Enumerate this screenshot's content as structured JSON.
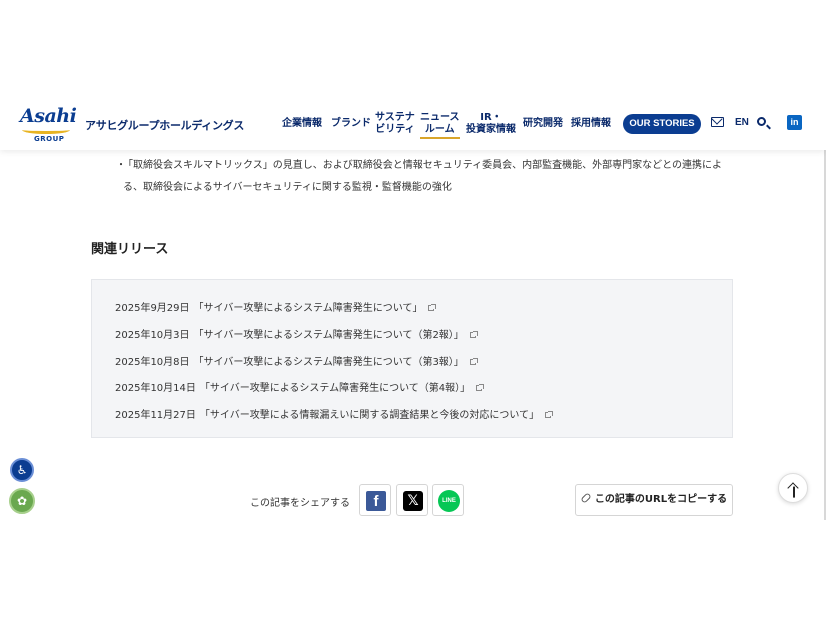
{
  "header": {
    "logo": {
      "word": "Asahi",
      "sub": "GROUP"
    },
    "company_name": "アサヒグループホールディングス",
    "nav": [
      {
        "line1": "企業情報",
        "line2": ""
      },
      {
        "line1": "ブランド",
        "line2": ""
      },
      {
        "line1": "サステナ",
        "line2": "ビリティ"
      },
      {
        "line1": "ニュース",
        "line2": "ルーム"
      },
      {
        "line1": "IR・",
        "line2": "投資家情報"
      },
      {
        "line1": "研究開発",
        "line2": ""
      },
      {
        "line1": "採用情報",
        "line2": ""
      }
    ],
    "our_stories": "OUR STORIES",
    "lang": "EN",
    "linkedin": "in"
  },
  "body": {
    "bullet": "・",
    "bullet_text": "「取締役会スキルマトリックス」の見直し、および取締役会と情報セキュリティ委員会、内部監査機能、外部専門家などとの連携による、取締役会によるサイバーセキュリティに関する監視・監督機能の強化",
    "related_title": "関連リリース",
    "releases": [
      {
        "date": "2025年9月29日",
        "title": "「サイバー攻撃によるシステム障害発生について」"
      },
      {
        "date": "2025年10月3日",
        "title": "「サイバー攻撃によるシステム障害発生について（第2報）」"
      },
      {
        "date": "2025年10月8日",
        "title": "「サイバー攻撃によるシステム障害発生について（第3報）」"
      },
      {
        "date": "2025年10月14日",
        "title": "「サイバー攻撃によるシステム障害発生について（第4報）」"
      },
      {
        "date": "2025年11月27日",
        "title": "「サイバー攻撃による情報漏えいに関する調査結果と今後の対応について」"
      }
    ]
  },
  "share": {
    "label": "この記事をシェアする",
    "facebook": "f",
    "x": "𝕏",
    "line": "LINE",
    "copy_url": "この記事のURLをコピーする"
  },
  "floating": {
    "accessibility": "♿",
    "cookie": "✿"
  }
}
